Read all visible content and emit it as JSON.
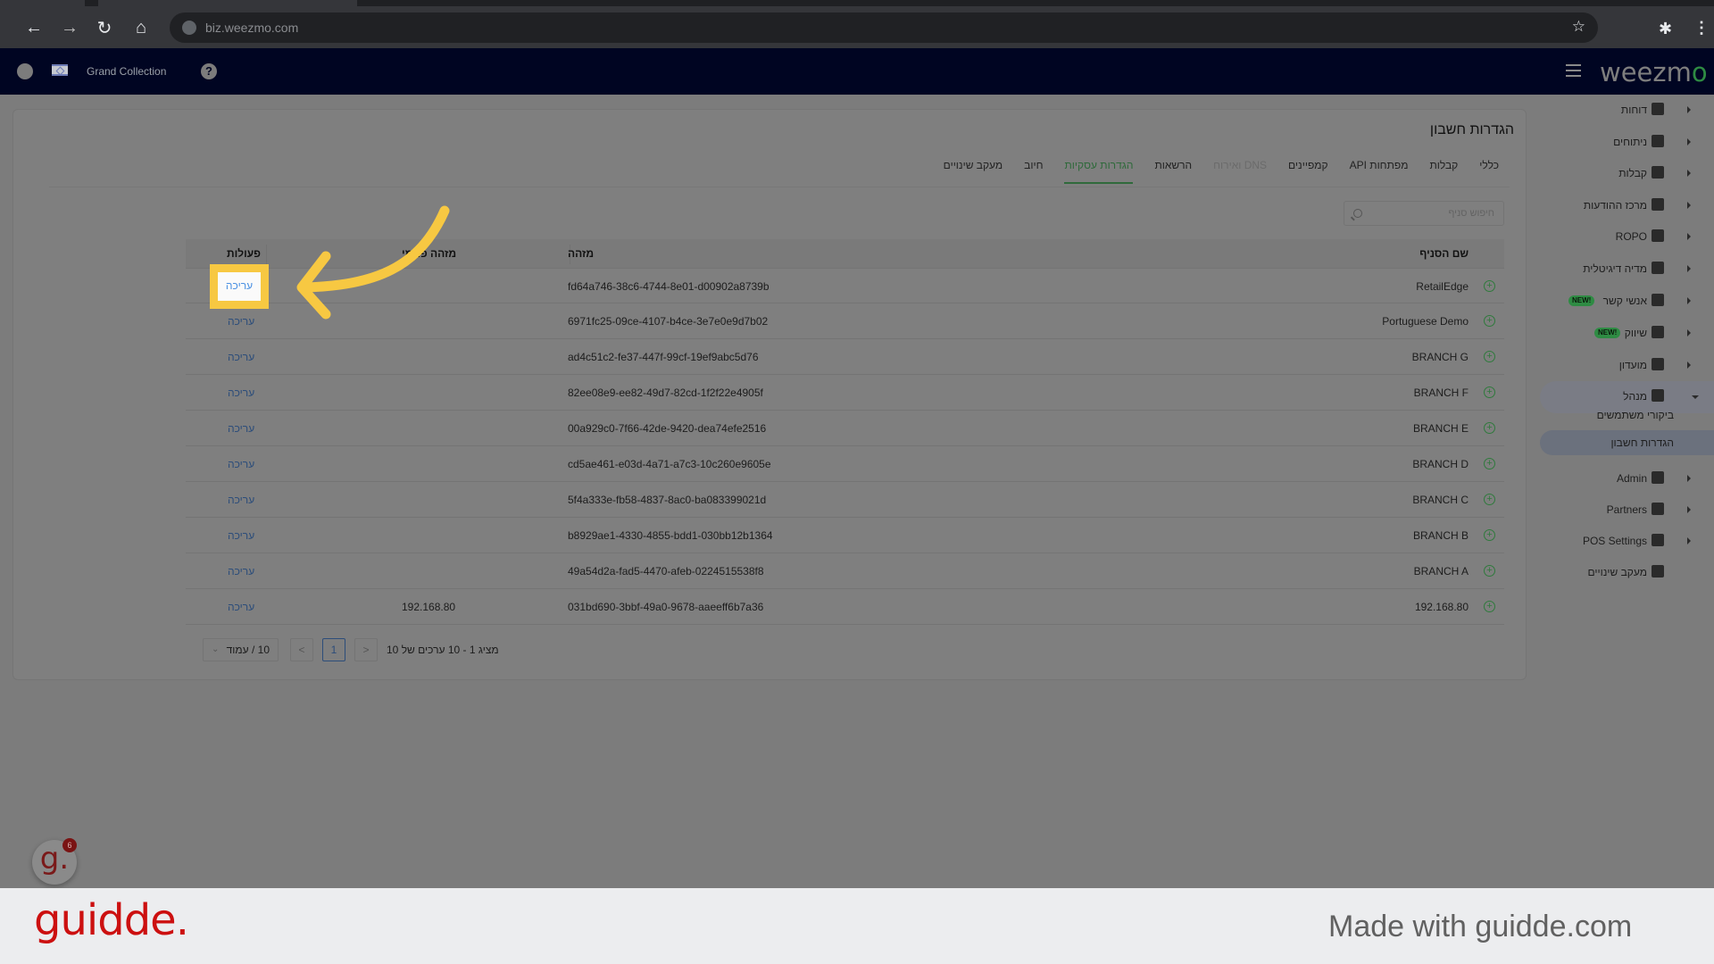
{
  "browser": {
    "url": "biz.weezmo.com",
    "icons": [
      "back-icon",
      "forward-icon",
      "reload-icon",
      "home-icon",
      "globe-icon",
      "star-icon",
      "extensions-icon",
      "kebab-menu-icon"
    ]
  },
  "header": {
    "store_name": "Grand Collection",
    "logo_text": "weezm",
    "logo_accent": "o",
    "brand_color": "#2e8b43"
  },
  "page": {
    "title": "הגדרות חשבון",
    "tabs": [
      {
        "label": "כללי",
        "state": "normal"
      },
      {
        "label": "קבלות",
        "state": "normal"
      },
      {
        "label": "מפתחות API",
        "state": "normal"
      },
      {
        "label": "קמפיינים",
        "state": "normal"
      },
      {
        "label": "DNS ואירוח",
        "state": "disabled"
      },
      {
        "label": "הרשאות",
        "state": "normal"
      },
      {
        "label": "הגדרות עסקיות",
        "state": "active"
      },
      {
        "label": "חיוב",
        "state": "normal"
      },
      {
        "label": "מעקב שינויים",
        "state": "normal"
      }
    ],
    "search_placeholder": "חיפוש סניף"
  },
  "table": {
    "headers": {
      "name": "שם הסניף",
      "id": "מזהה",
      "internal_id": "מזהה פנימי",
      "actions": "פעולות"
    },
    "rows": [
      {
        "name": "RetailEdge",
        "id": "fd64a746-38c6-4744-8e01-d00902a8739b",
        "internal_id": "",
        "action": "עריכה"
      },
      {
        "name": "Portuguese Demo",
        "id": "6971fc25-09ce-4107-b4ce-3e7e0e9d7b02",
        "internal_id": "",
        "action": "עריכה"
      },
      {
        "name": "BRANCH G",
        "id": "ad4c51c2-fe37-447f-99cf-19ef9abc5d76",
        "internal_id": "",
        "action": "עריכה"
      },
      {
        "name": "BRANCH F",
        "id": "82ee08e9-ee82-49d7-82cd-1f2f22e4905f",
        "internal_id": "",
        "action": "עריכה"
      },
      {
        "name": "BRANCH E",
        "id": "00a929c0-7f66-42de-9420-dea74efe2516",
        "internal_id": "",
        "action": "עריכה"
      },
      {
        "name": "BRANCH D",
        "id": "cd5ae461-e03d-4a71-a7c3-10c260e9605e",
        "internal_id": "",
        "action": "עריכה"
      },
      {
        "name": "BRANCH C",
        "id": "5f4a333e-fb58-4837-8ac0-ba083399021d",
        "internal_id": "",
        "action": "עריכה"
      },
      {
        "name": "BRANCH B",
        "id": "b8929ae1-4330-4855-bdd1-030bb12b1364",
        "internal_id": "",
        "action": "עריכה"
      },
      {
        "name": "BRANCH A",
        "id": "49a54d2a-fad5-4470-afeb-0224515538f8",
        "internal_id": "",
        "action": "עריכה"
      },
      {
        "name": "192.168.80",
        "id": "031bd690-3bbf-49a0-9678-aaeeff6b7a36",
        "internal_id": "192.168.80",
        "action": "עריכה"
      }
    ]
  },
  "pagination": {
    "info": "מציג 1 - 10 ערכים של 10",
    "current_page": "1",
    "prev": "<",
    "next": ">",
    "page_size": "10 / עמוד"
  },
  "sidebar": {
    "items": [
      {
        "label": "דוחות",
        "icon": "dashboard-icon"
      },
      {
        "label": "ניתוחים",
        "icon": "analytics-icon"
      },
      {
        "label": "קבלות",
        "icon": "receipt-icon"
      },
      {
        "label": "מרכז ההודעות",
        "icon": "message-icon"
      },
      {
        "label": "ROPO",
        "icon": "infinity-icon"
      },
      {
        "label": "מדיה דיגיטלית",
        "icon": "people-icon"
      },
      {
        "label": "אנשי קשר",
        "icon": "contacts-icon",
        "badge": "NEW!"
      },
      {
        "label": "שיווק",
        "icon": "celebration-icon",
        "badge": "NEW!"
      },
      {
        "label": "מועדון",
        "icon": "tag-icon"
      },
      {
        "label": "מנהל",
        "icon": "gear-icon",
        "expanded": true
      },
      {
        "label": "Admin",
        "icon": "admin-gear-icon"
      },
      {
        "label": "Partners",
        "icon": "handshake-icon"
      },
      {
        "label": "POS Settings",
        "icon": "cash-register-icon"
      },
      {
        "label": "מעקב שינויים",
        "icon": "zoom-in-icon"
      }
    ],
    "sub_items": [
      {
        "label": "ביקורי משתמשים",
        "active": false
      },
      {
        "label": "הגדרות חשבון",
        "active": true
      }
    ]
  },
  "annotation": {
    "highlighted_action": "עריכה",
    "highlight_color": "#f7c842"
  },
  "guidde": {
    "bubble_letter": "g.",
    "badge_count": "6",
    "brand": "guidde.",
    "made_with": "Made with guidde.com"
  }
}
